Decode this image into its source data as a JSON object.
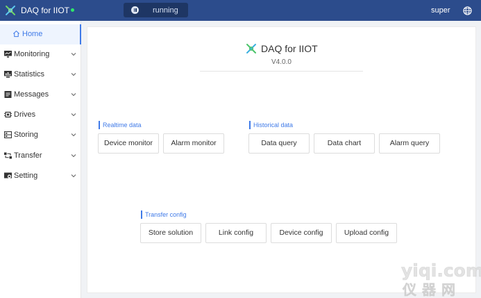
{
  "header": {
    "app_title": "DAQ for IIOT",
    "status": "running",
    "user": "super"
  },
  "sidebar": {
    "items": [
      {
        "label": "Home",
        "icon": "home-icon"
      },
      {
        "label": "Monitoring",
        "icon": "monitor-icon"
      },
      {
        "label": "Statistics",
        "icon": "statistics-icon"
      },
      {
        "label": "Messages",
        "icon": "messages-icon"
      },
      {
        "label": "Drives",
        "icon": "chip-icon"
      },
      {
        "label": "Storing",
        "icon": "storage-icon"
      },
      {
        "label": "Transfer",
        "icon": "transfer-icon"
      },
      {
        "label": "Setting",
        "icon": "setting-icon"
      }
    ]
  },
  "main": {
    "title": "DAQ for IIOT",
    "version": "V4.0.0",
    "realtime": {
      "label": "Realtime data",
      "buttons": [
        "Device monitor",
        "Alarm monitor"
      ]
    },
    "historical": {
      "label": "Historical data",
      "buttons": [
        "Data query",
        "Data chart",
        "Alarm query"
      ]
    },
    "transfer": {
      "label": "Transfer config",
      "buttons": [
        "Store solution",
        "Link config",
        "Device config",
        "Upload config"
      ]
    }
  },
  "watermark": {
    "domain": "yiqi.com",
    "cn": "仪 器 网"
  },
  "colors": {
    "header_bg": "#2c4c8c",
    "accent": "#3f7ae8",
    "status_dot": "#2ee86a"
  }
}
